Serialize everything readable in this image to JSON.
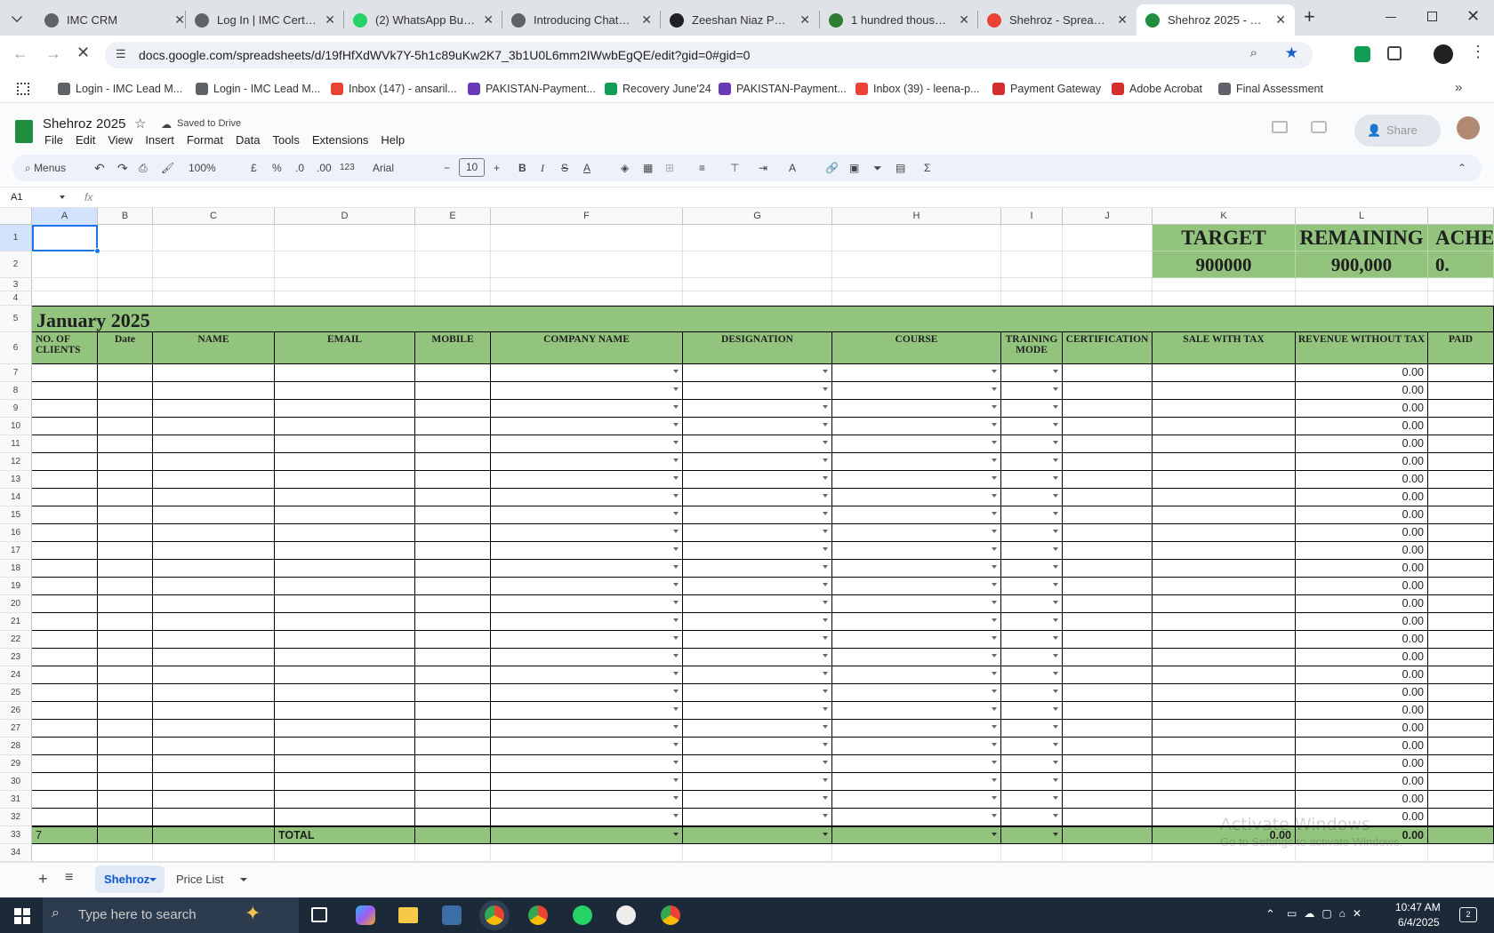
{
  "browser": {
    "tabs": [
      {
        "title": "IMC CRM",
        "color": "#5f6368"
      },
      {
        "title": "Log In | IMC Certific",
        "color": "#5f6368"
      },
      {
        "title": "(2) WhatsApp Busin",
        "color": "#25d366"
      },
      {
        "title": "Introducing ChatGP",
        "color": "#5f6368"
      },
      {
        "title": "Zeeshan Niaz PMP F",
        "color": "#202124"
      },
      {
        "title": "1 hundred thousand",
        "color": "#2e7d32"
      },
      {
        "title": "Shehroz - Spread sh",
        "color": "#ea4335"
      },
      {
        "title": "Shehroz 2025 - Goo",
        "color": "#1e8e3e"
      }
    ],
    "new_tab": "+",
    "url": "docs.google.com/spreadsheets/d/19fHfXdWVk7Y-5h1c89uKw2K7_3b1U0L6mm2IWwbEgQE/edit?gid=0#gid=0",
    "bookmarks": [
      {
        "label": "Login - IMC Lead M...",
        "color": "#5f6368"
      },
      {
        "label": "Login - IMC Lead M...",
        "color": "#5f6368"
      },
      {
        "label": "Inbox (147) - ansaril...",
        "color": "#ea4335"
      },
      {
        "label": "PAKISTAN-Payment...",
        "color": "#673ab7"
      },
      {
        "label": "Recovery June'24",
        "color": "#0f9d58"
      },
      {
        "label": "PAKISTAN-Payment...",
        "color": "#673ab7"
      },
      {
        "label": "Inbox (39) - leena-p...",
        "color": "#ea4335"
      },
      {
        "label": "Payment Gateway",
        "color": "#d32f2f"
      },
      {
        "label": "Adobe Acrobat",
        "color": "#d32f2f"
      },
      {
        "label": "Final Assessment",
        "color": "#5f6368"
      }
    ]
  },
  "doc": {
    "title": "Shehroz 2025",
    "saved": "Saved to Drive",
    "menus": [
      "File",
      "Edit",
      "View",
      "Insert",
      "Format",
      "Data",
      "Tools",
      "Extensions",
      "Help"
    ],
    "share": "Share"
  },
  "toolbar": {
    "search": "Menus",
    "zoom": "100%",
    "currency": "£",
    "percent": "%",
    "dec_less": ".0",
    "dec_more": ".00",
    "fmt": "123",
    "font": "Arial",
    "size": "10"
  },
  "formula": {
    "cellref": "A1",
    "fx": "fx"
  },
  "columns": [
    "A",
    "B",
    "C",
    "D",
    "E",
    "F",
    "G",
    "H",
    "I",
    "J",
    "K",
    "L"
  ],
  "summary": {
    "target_label": "TARGET",
    "target_value": "900000",
    "remaining_label": "REMAINING",
    "remaining_value": "900,000",
    "ach_label": "ACHE",
    "ach_value": "0."
  },
  "month_title": "January 2025",
  "headers": [
    "NO. OF CLIENTS",
    "Date",
    "NAME",
    "EMAIL",
    "MOBILE",
    "COMPANY NAME",
    "DESIGNATION",
    "COURSE",
    "TRAINING MODE",
    "CERTIFICATION",
    "SALE WITH TAX",
    "REVENUE WITHOUT TAX",
    "PAID"
  ],
  "row_value": "0.00",
  "total_row": {
    "count": "7",
    "label": "TOTAL",
    "sale": "0.00",
    "revenue": "0.00"
  },
  "sheets": [
    "Shehroz",
    "Price List"
  ],
  "watermark": {
    "line1": "Activate Windows",
    "line2": "Go to Settings to activate Windows."
  },
  "taskbar": {
    "search": "Type here to search",
    "time": "10:47 AM",
    "date": "6/4/2025",
    "notif": "2"
  }
}
